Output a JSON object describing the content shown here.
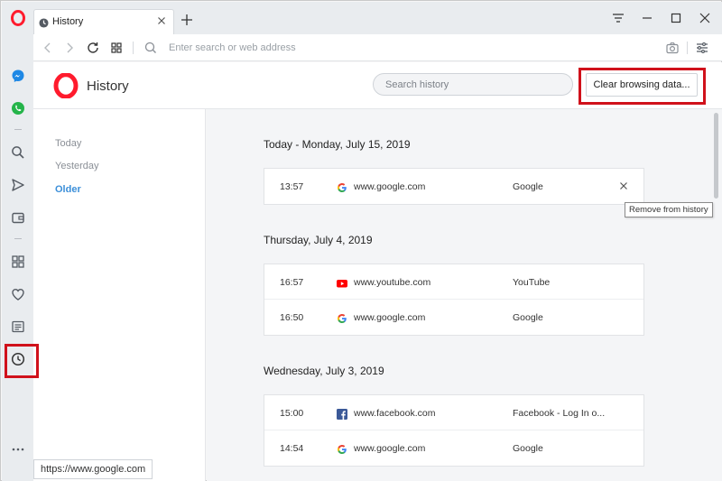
{
  "colors": {
    "accent": "#3c8fd9",
    "opera_red": "#ff1b2d",
    "highlight_red": "#d0111b"
  },
  "tab": {
    "title": "History"
  },
  "addressbar": {
    "placeholder": "Enter search or web address"
  },
  "sidebar": {
    "icons": [
      "opera-menu-icon",
      "messenger-icon",
      "whatsapp-icon",
      "search-icon",
      "send-icon",
      "wallet-icon",
      "speed-dial-icon",
      "heart-icon",
      "news-icon",
      "history-icon",
      "more-icon"
    ]
  },
  "header": {
    "title": "History",
    "search_placeholder": "Search history",
    "clear_label": "Clear browsing data..."
  },
  "filters": [
    {
      "label": "Today",
      "active": false
    },
    {
      "label": "Yesterday",
      "active": false
    },
    {
      "label": "Older",
      "active": true
    }
  ],
  "days": [
    {
      "title": "Today - Monday, July 15, 2019",
      "entries": [
        {
          "time": "13:57",
          "icon": "google-icon",
          "url": "www.google.com",
          "title": "Google"
        }
      ]
    },
    {
      "title": "Thursday, July 4, 2019",
      "entries": [
        {
          "time": "16:57",
          "icon": "youtube-icon",
          "url": "www.youtube.com",
          "title": "YouTube"
        },
        {
          "time": "16:50",
          "icon": "google-icon",
          "url": "www.google.com",
          "title": "Google"
        }
      ]
    },
    {
      "title": "Wednesday, July 3, 2019",
      "entries": [
        {
          "time": "15:00",
          "icon": "facebook-icon",
          "url": "www.facebook.com",
          "title": "Facebook - Log In o..."
        },
        {
          "time": "14:54",
          "icon": "google-icon",
          "url": "www.google.com",
          "title": "Google"
        }
      ]
    }
  ],
  "tooltip": "Remove from history",
  "status_url": "https://www.google.com"
}
